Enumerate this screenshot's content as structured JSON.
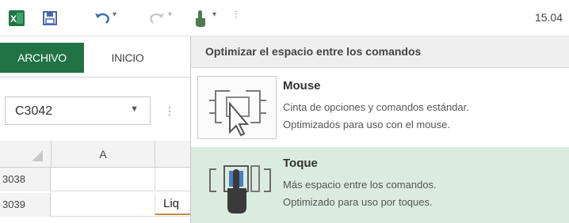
{
  "qat": {
    "icons": [
      "excel-logo-icon",
      "save-icon",
      "undo-icon",
      "redo-icon",
      "touch-mode-icon",
      "customize-qat-icon"
    ],
    "time": "15.04"
  },
  "ribbon": {
    "tabs": [
      "ARCHIVO",
      "INICIO"
    ]
  },
  "namebox": {
    "value": "C3042",
    "separator": "⋮"
  },
  "grid": {
    "column_header": "A",
    "rows": [
      {
        "number": "3038",
        "col_b": ""
      },
      {
        "number": "3039",
        "col_b": "Liq"
      }
    ]
  },
  "menu": {
    "header": "Optimizar el espacio entre los comandos",
    "items": [
      {
        "title": "Mouse",
        "line1": "Cinta de opciones y comandos estándar.",
        "line2": "Optimizados para uso con el mouse.",
        "icon": "mouse-mode-icon",
        "selected": false
      },
      {
        "title": "Toque",
        "line1": "Más espacio entre los comandos.",
        "line2": "Optimizado para uso por toques.",
        "icon": "touch-mode-icon",
        "selected": true
      }
    ]
  },
  "colors": {
    "excel_green": "#217346",
    "selected_bg": "#dcebe0"
  }
}
